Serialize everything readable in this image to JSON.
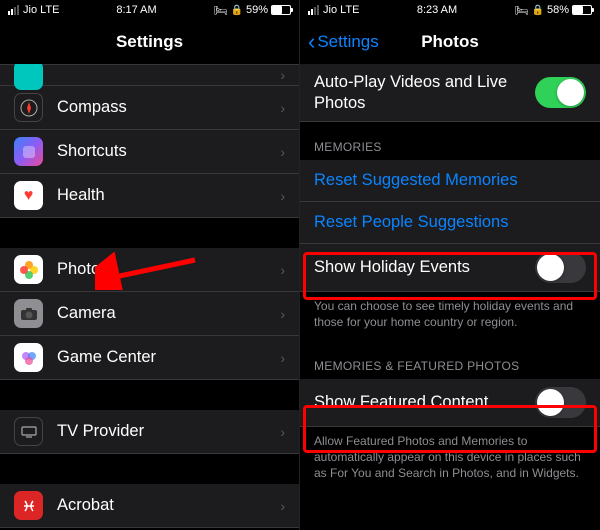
{
  "left": {
    "status": {
      "carrier": "Jio  LTE",
      "time": "8:17 AM",
      "battery": "59%"
    },
    "title": "Settings",
    "rows": {
      "compass": "Compass",
      "shortcuts": "Shortcuts",
      "health": "Health",
      "photos": "Photos",
      "camera": "Camera",
      "gamecenter": "Game Center",
      "tvprovider": "TV Provider",
      "acrobat": "Acrobat"
    }
  },
  "right": {
    "status": {
      "carrier": "Jio  LTE",
      "time": "8:23 AM",
      "battery": "58%"
    },
    "back": "Settings",
    "title": "Photos",
    "autoplay": "Auto-Play Videos and Live Photos",
    "section_memories": "MEMORIES",
    "reset_memories": "Reset Suggested Memories",
    "reset_people": "Reset People Suggestions",
    "holiday": "Show Holiday Events",
    "holiday_footer": "You can choose to see timely holiday events and those for your home country or region.",
    "section_featured": "MEMORIES & FEATURED PHOTOS",
    "featured": "Show Featured Content",
    "featured_footer": "Allow Featured Photos and Memories to automatically appear on this device in places such as For You and Search in Photos, and in Widgets."
  }
}
